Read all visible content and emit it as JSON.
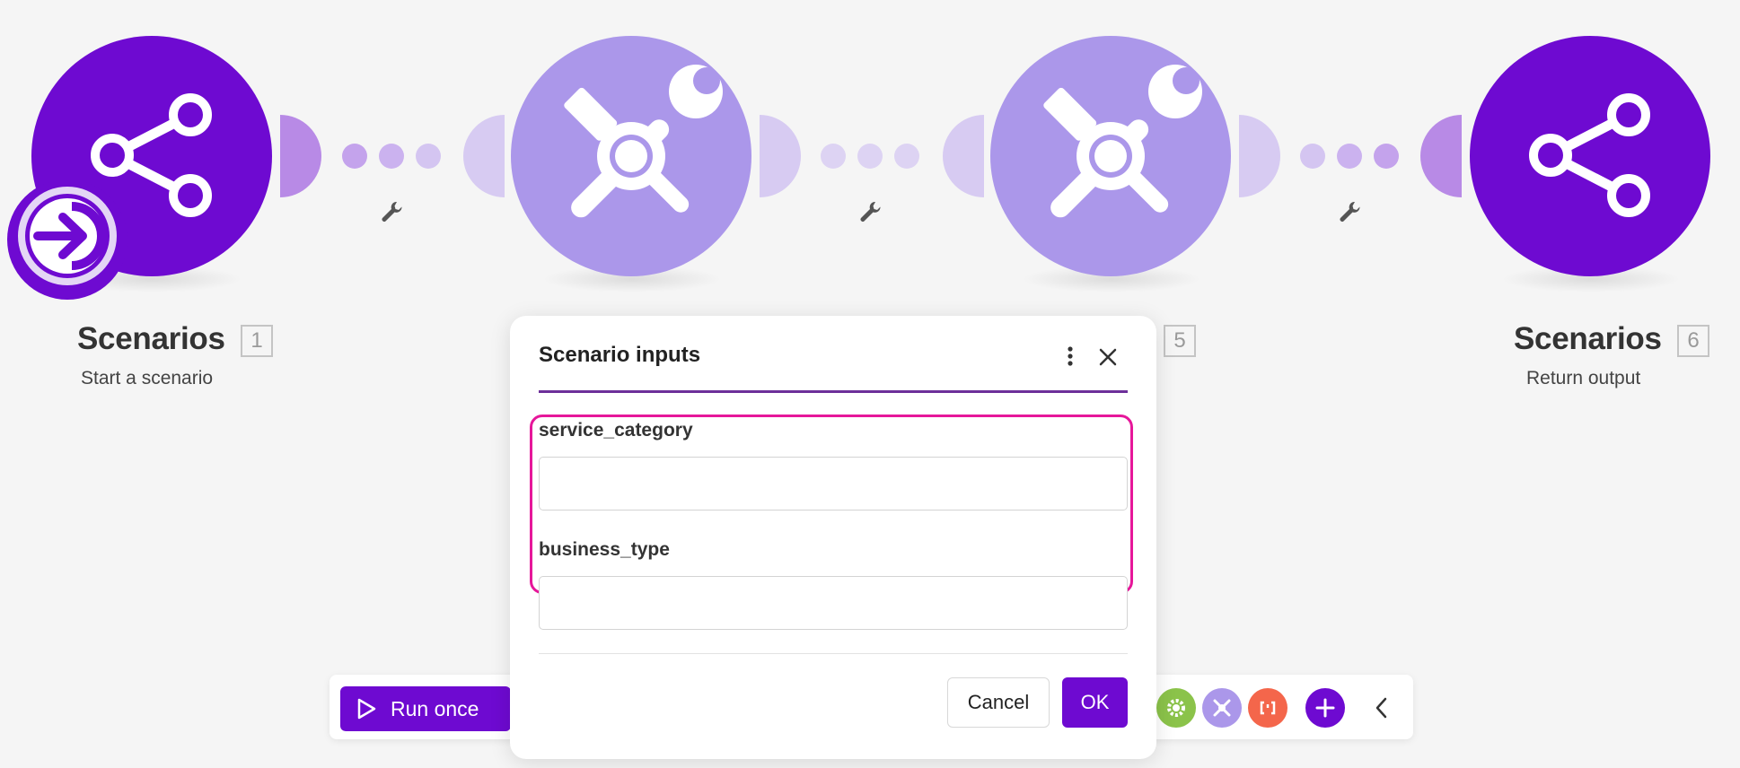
{
  "modules": [
    {
      "title": "Scenarios",
      "number": "1",
      "subtitle": "Start a scenario",
      "icon": "share-icon"
    },
    {
      "title": "",
      "number": "",
      "subtitle": "",
      "icon": "tools-icon"
    },
    {
      "title": "",
      "number": "5",
      "subtitle": "",
      "icon": "tools-icon"
    },
    {
      "title": "Scenarios",
      "number": "6",
      "subtitle": "Return output",
      "icon": "share-icon"
    }
  ],
  "dialog": {
    "title": "Scenario inputs",
    "fields": [
      {
        "label": "service_category",
        "value": ""
      },
      {
        "label": "business_type",
        "value": ""
      }
    ],
    "cancel_label": "Cancel",
    "ok_label": "OK"
  },
  "toolbar": {
    "run_label": "Run once",
    "tools": [
      "gear-icon",
      "tools-icon",
      "bracket-icon",
      "plus-icon",
      "chevron-left-icon"
    ]
  },
  "colors": {
    "primary": "#6e0ad1",
    "tool_light": "#ab97ea",
    "highlight": "#e6179a",
    "gear_green": "#8bc34a",
    "bracket_orange": "#f4664b"
  }
}
